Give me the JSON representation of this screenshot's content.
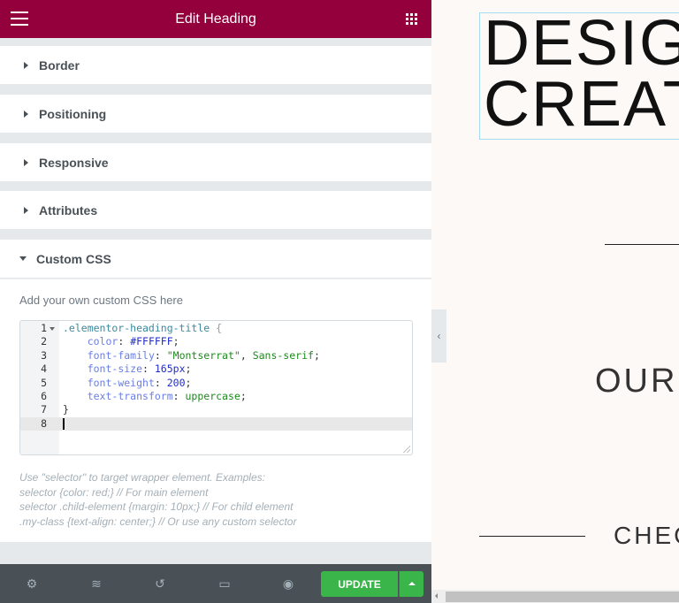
{
  "header": {
    "title": "Edit Heading",
    "menu_icon": "hamburger-icon",
    "widgets_icon": "grid-icon"
  },
  "sections": [
    {
      "label": "Border",
      "expanded": false
    },
    {
      "label": "Positioning",
      "expanded": false
    },
    {
      "label": "Responsive",
      "expanded": false
    },
    {
      "label": "Attributes",
      "expanded": false
    },
    {
      "label": "Custom CSS",
      "expanded": true
    }
  ],
  "custom_css": {
    "hint": "Add your own custom CSS here",
    "lines": [
      {
        "n": "1",
        "selector": ".elementor-heading-title",
        "rest": " {"
      },
      {
        "n": "2",
        "prop": "color",
        "val": "#FFFFFF"
      },
      {
        "n": "3",
        "prop": "font-family",
        "val": "\"Montserrat\"",
        "val2": "Sans-serif"
      },
      {
        "n": "4",
        "prop": "font-size",
        "val": "165px"
      },
      {
        "n": "5",
        "prop": "font-weight",
        "val": "200"
      },
      {
        "n": "6",
        "prop": "text-transform",
        "val": "uppercase"
      },
      {
        "n": "7",
        "text": "}"
      },
      {
        "n": "8",
        "text": ""
      }
    ],
    "help": [
      "Use \"selector\" to target wrapper element. Examples:",
      "selector {color: red;} // For main element",
      "selector .child-element {margin: 10px;} // For child element",
      ".my-class {text-align: center;} // Or use any custom selector"
    ]
  },
  "footer": {
    "icons": [
      "settings-icon",
      "layers-icon",
      "history-icon",
      "responsive-mode-icon",
      "preview-eye-icon"
    ],
    "update_label": "UPDATE"
  },
  "preview": {
    "heading_lines": [
      "DESIG",
      "CREAT"
    ],
    "text1": "OUR",
    "text2": "CHEC"
  },
  "colors": {
    "header": "#93003c",
    "update": "#39b54a",
    "footer": "#495157"
  }
}
